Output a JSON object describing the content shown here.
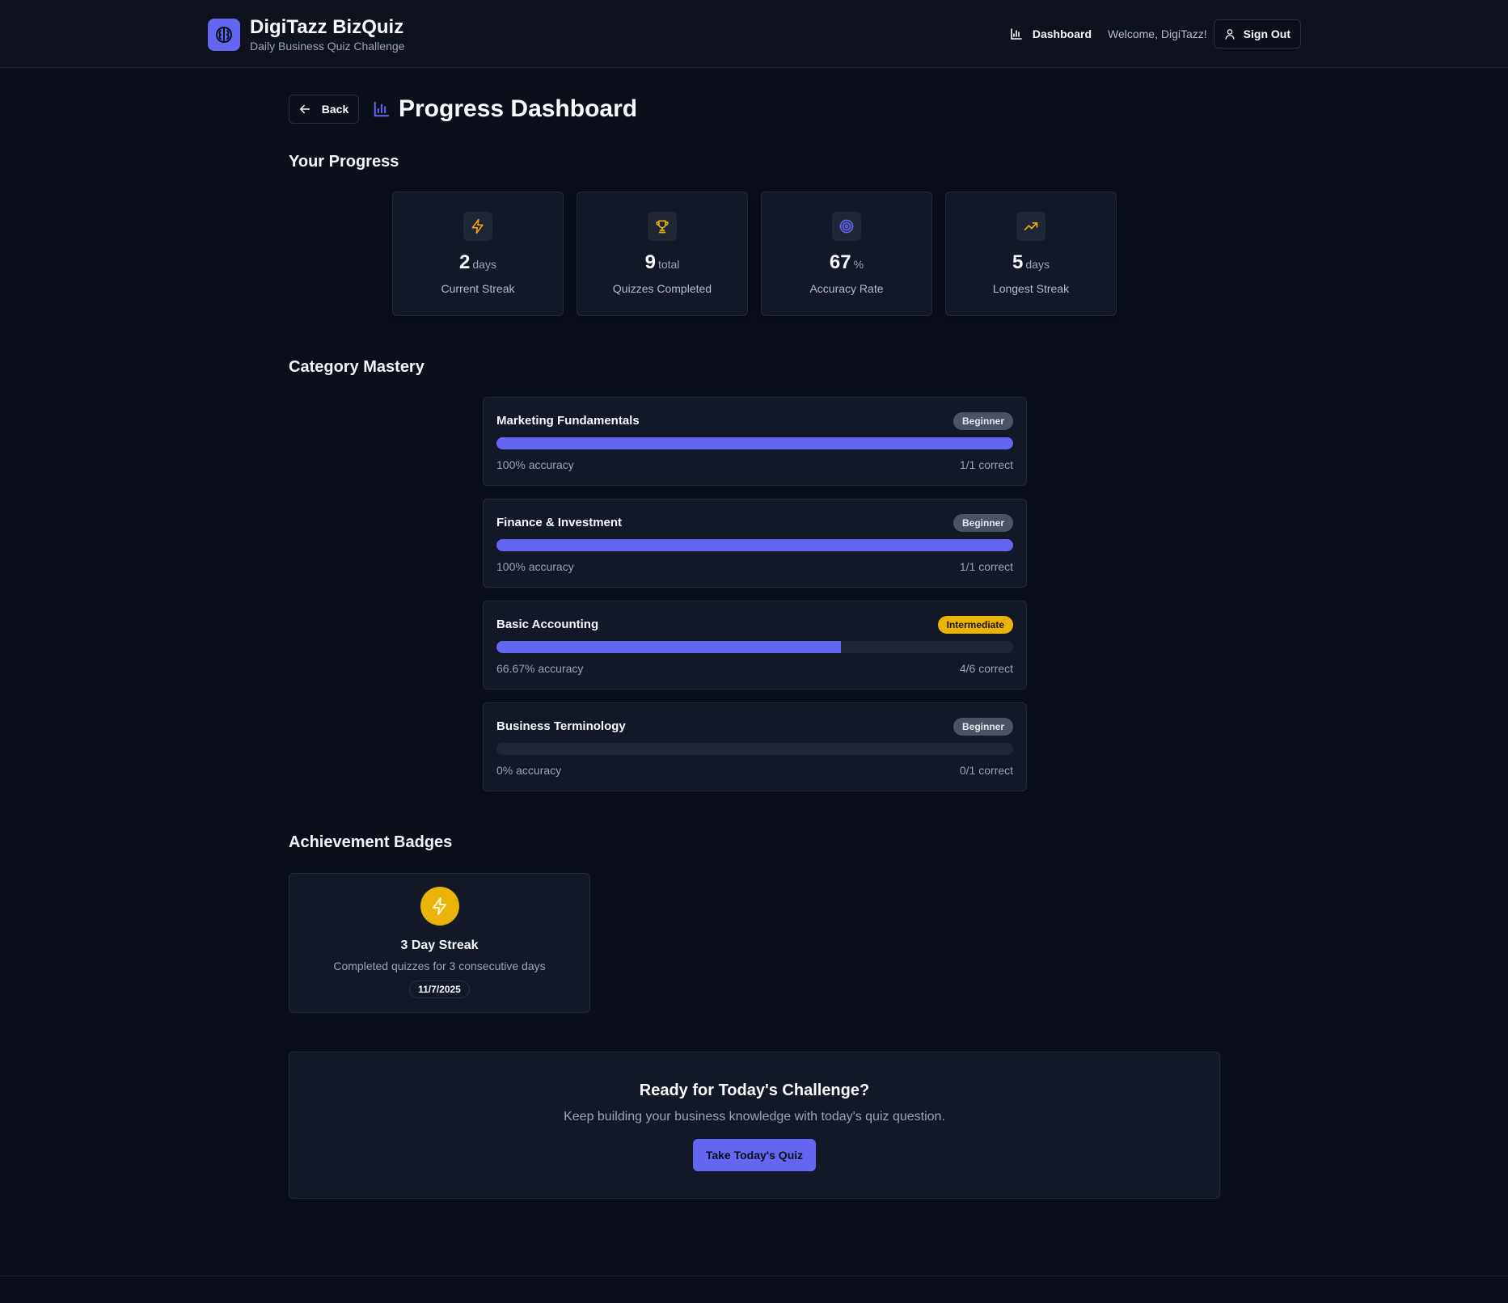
{
  "header": {
    "brand_title": "DigiTazz BizQuiz",
    "brand_subtitle": "Daily Business Quiz Challenge",
    "nav_dashboard": "Dashboard",
    "welcome": "Welcome, DigiTazz!",
    "sign_out": "Sign Out"
  },
  "page": {
    "back_label": "Back",
    "title": "Progress Dashboard"
  },
  "progress": {
    "section_title": "Your Progress",
    "stats": [
      {
        "value": "2",
        "unit": "days",
        "label": "Current Streak",
        "icon": "zap-icon",
        "color": "#f59e0b"
      },
      {
        "value": "9",
        "unit": "total",
        "label": "Quizzes Completed",
        "icon": "trophy-icon",
        "color": "#eab308"
      },
      {
        "value": "67",
        "unit": "%",
        "label": "Accuracy Rate",
        "icon": "target-icon",
        "color": "#6366f1"
      },
      {
        "value": "5",
        "unit": "days",
        "label": "Longest Streak",
        "icon": "trending-up-icon",
        "color": "#eab308"
      }
    ]
  },
  "mastery": {
    "section_title": "Category Mastery",
    "categories": [
      {
        "name": "Marketing Fundamentals",
        "level": "Beginner",
        "accuracy_pct": 100,
        "accuracy_text": "100% accuracy",
        "correct": "1/1 correct"
      },
      {
        "name": "Finance & Investment",
        "level": "Beginner",
        "accuracy_pct": 100,
        "accuracy_text": "100% accuracy",
        "correct": "1/1 correct"
      },
      {
        "name": "Basic Accounting",
        "level": "Intermediate",
        "accuracy_pct": 66.67,
        "accuracy_text": "66.67% accuracy",
        "correct": "4/6 correct"
      },
      {
        "name": "Business Terminology",
        "level": "Beginner",
        "accuracy_pct": 0,
        "accuracy_text": "0% accuracy",
        "correct": "0/1 correct"
      }
    ]
  },
  "achievements": {
    "section_title": "Achievement Badges",
    "badges": [
      {
        "name": "3 Day Streak",
        "description": "Completed quizzes for 3 consecutive days",
        "date": "11/7/2025",
        "icon": "zap-icon"
      }
    ]
  },
  "cta": {
    "title": "Ready for Today's Challenge?",
    "text": "Keep building your business knowledge with today's quiz question.",
    "button": "Take Today's Quiz"
  },
  "colors": {
    "accent": "#6366f1",
    "gold": "#eab308",
    "background": "#0b0f19",
    "card": "#121826"
  }
}
